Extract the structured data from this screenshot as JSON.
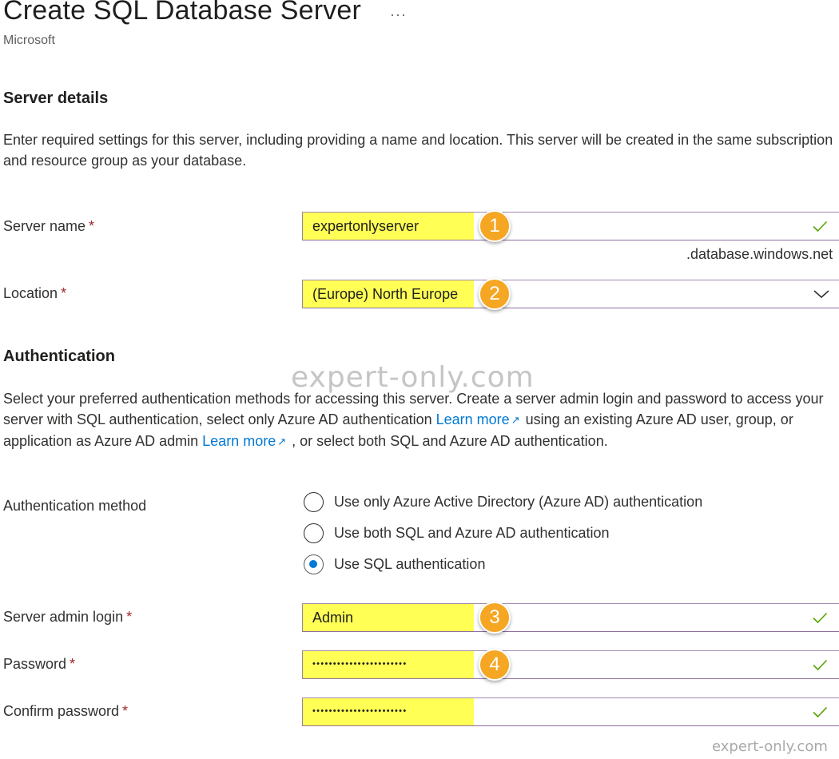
{
  "header": {
    "title": "Create SQL Database Server",
    "more_label": "···",
    "subtitle": "Microsoft"
  },
  "server_details": {
    "heading": "Server details",
    "description": "Enter required settings for this server, including providing a name and location. This server will be created in the same subscription and resource group as your database.",
    "server_name": {
      "label": "Server name",
      "required_mark": "*",
      "value": "expertonlyserver",
      "suffix": ".database.windows.net",
      "badge": "1",
      "status_icon": "checkmark-icon"
    },
    "location": {
      "label": "Location",
      "required_mark": "*",
      "value": "(Europe) North Europe",
      "badge": "2",
      "dropdown_icon": "chevron-down-icon"
    }
  },
  "authentication": {
    "heading": "Authentication",
    "description_part1": "Select your preferred authentication methods for accessing this server. Create a server admin login and password to access your server with SQL authentication, select only Azure AD authentication ",
    "link1": "Learn more",
    "description_part2": " using an existing Azure AD user, group, or application as Azure AD admin ",
    "link2": "Learn more",
    "description_part3": " , or select both SQL and Azure AD authentication.",
    "external_link_icon": "external-link-icon",
    "method": {
      "label": "Authentication method",
      "options": [
        {
          "label": "Use only Azure Active Directory (Azure AD) authentication",
          "selected": false
        },
        {
          "label": "Use both SQL and Azure AD authentication",
          "selected": false
        },
        {
          "label": "Use SQL authentication",
          "selected": true
        }
      ]
    },
    "admin_login": {
      "label": "Server admin login",
      "required_mark": "*",
      "value": "Admin",
      "badge": "3"
    },
    "password": {
      "label": "Password",
      "required_mark": "*",
      "masked_value": "•••••••••••••••••••••••",
      "badge": "4"
    },
    "confirm_password": {
      "label": "Confirm password",
      "required_mark": "*",
      "masked_value": "•••••••••••••••••••••••"
    }
  },
  "watermark": "expert-only.com",
  "footer_watermark": "expert-only.com",
  "colors": {
    "highlight": "#ffff55",
    "badge": "#f5a623",
    "link": "#0078d4",
    "required": "#a4262c",
    "check": "#57a300"
  }
}
